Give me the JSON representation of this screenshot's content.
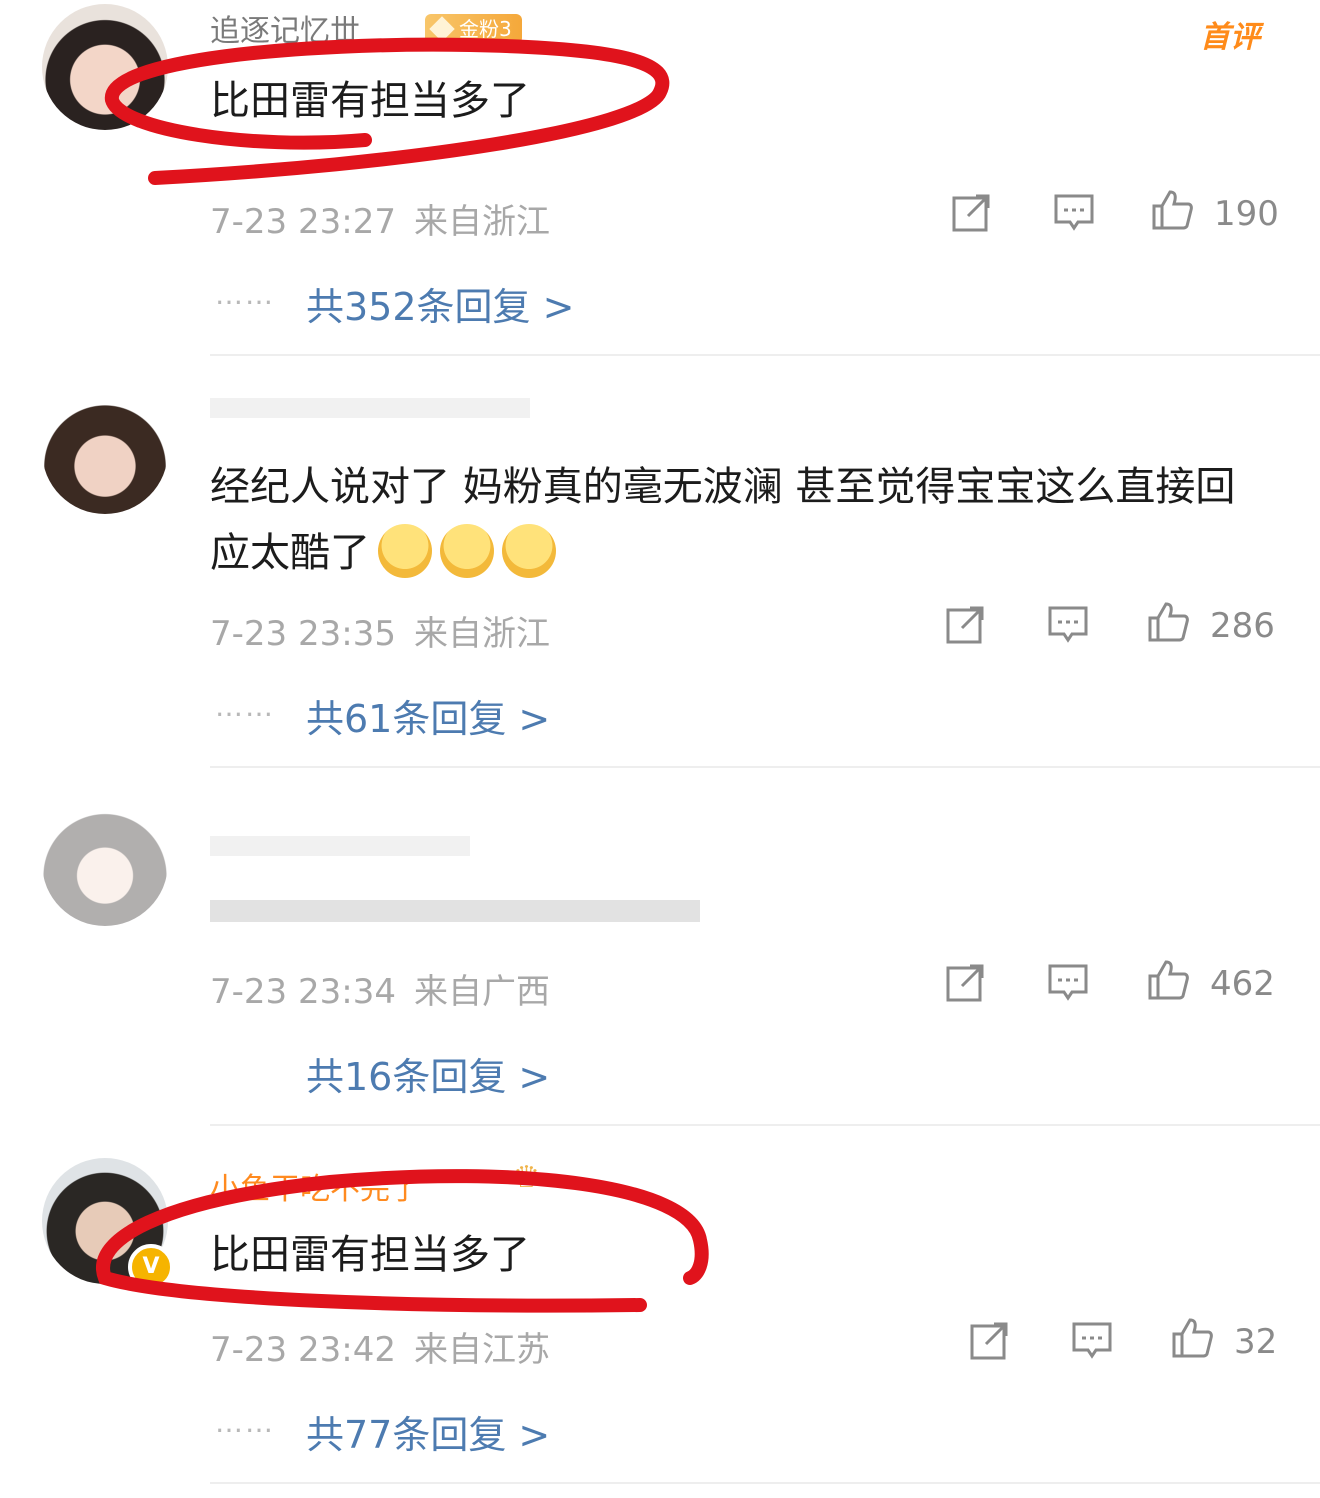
{
  "comments": [
    {
      "username": "追逐记忆丗",
      "fan_badge": "金粉3",
      "first_badge": "首评",
      "text": "比田雷有担当多了",
      "time": "7-23 23:27",
      "location": "来自浙江",
      "likes": "190",
      "replies": "共352条回复 >",
      "dots": "……"
    },
    {
      "username": "",
      "text": "经纪人说对了 妈粉真的毫无波澜 甚至觉得宝宝这么直接回应太酷了",
      "time": "7-23 23:35",
      "location": "来自浙江",
      "likes": "286",
      "replies": "共61条回复 >",
      "dots": "……"
    },
    {
      "username": "",
      "text": "",
      "time": "7-23 23:34",
      "location": "来自广西",
      "likes": "462",
      "replies": "共16条回复 >",
      "dots": ""
    },
    {
      "username": "小鱼干吃不完了",
      "verified_badge": "V",
      "text": "比田雷有担当多了",
      "time": "7-23 23:42",
      "location": "来自江苏",
      "likes": "32",
      "replies": "共77条回复 >",
      "dots": "……"
    }
  ],
  "colors": {
    "reply_link": "#4d7bb0",
    "annotation_red": "#e0131c",
    "accent_orange": "#ff8a1f"
  },
  "icons": [
    "share-icon",
    "comment-icon",
    "like-icon",
    "emoji-icon",
    "crown-icon"
  ]
}
